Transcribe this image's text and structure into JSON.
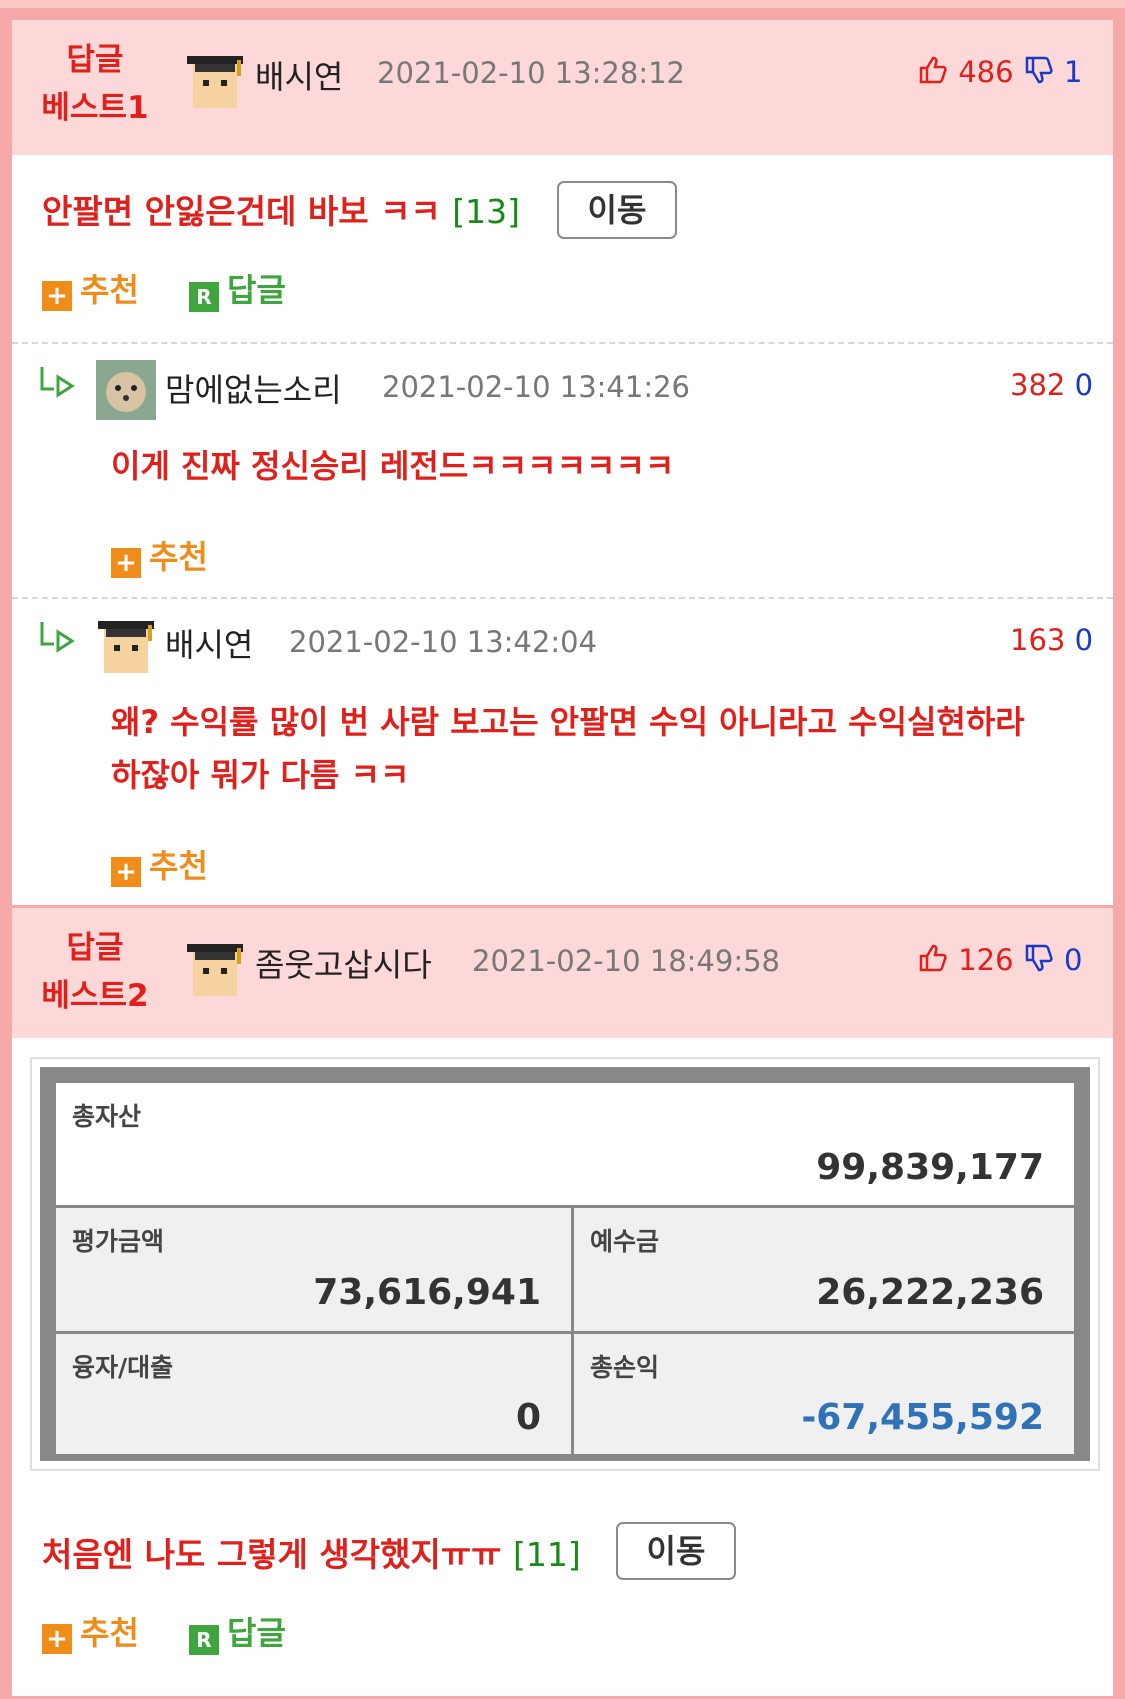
{
  "best1": {
    "label_line1": "답글",
    "label_line2": "베스트1",
    "nickname": "배시연",
    "timestamp": "2021-02-10 13:28:12",
    "up": "486",
    "down": "1",
    "title": "안팔면 안잃은건데 바보 ㅋㅋ",
    "comment_count": "[13]",
    "move_label": "이동",
    "recommend_label": "추천",
    "reply_label": "답글"
  },
  "replies": [
    {
      "nickname": "맘에없는소리",
      "timestamp": "2021-02-10 13:41:26",
      "up": "382",
      "down": "0",
      "text": "이게 진짜 정신승리 레전드ㅋㅋㅋㅋㅋㅋㅋ",
      "recommend_label": "추천"
    },
    {
      "nickname": "배시연",
      "timestamp": "2021-02-10 13:42:04",
      "up": "163",
      "down": "0",
      "text_line1": "왜? 수익률 많이 번 사람 보고는 안팔면 수익 아니라고 수익실현하라",
      "text_line2": "하잖아 뭐가 다름 ㅋㅋ",
      "recommend_label": "추천"
    }
  ],
  "best2": {
    "label_line1": "답글",
    "label_line2": "베스트2",
    "nickname": "좀웃고삽시다",
    "timestamp": "2021-02-10 18:49:58",
    "up": "126",
    "down": "0",
    "title": "처음엔 나도 그렇게 생각했지ㅠㅠ",
    "comment_count": "[11]",
    "move_label": "이동",
    "recommend_label": "추천",
    "reply_label": "답글"
  },
  "asset": {
    "total_label": "총자산",
    "total_value": "99,839,177",
    "eval_label": "평가금액",
    "eval_value": "73,616,941",
    "deposit_label": "예수금",
    "deposit_value": "26,222,236",
    "loan_label": "융자/대출",
    "loan_value": "0",
    "pnl_label": "총손익",
    "pnl_value": "-67,455,592"
  },
  "icons": {
    "thumbs_up": "thumbs-up-icon",
    "thumbs_down": "thumbs-down-icon",
    "reply_arrow": "reply-arrow-icon",
    "plus": "plus-icon",
    "r_badge": "r-badge-icon"
  },
  "colors": {
    "accent_red": "#e0201b",
    "accent_blue": "#1a39c9",
    "count_green": "#178a17",
    "recommend_orange": "#f08c1a",
    "reply_green": "#3fa53f",
    "header_pink": "#fdd8d8",
    "border_pink": "#f7a9a9",
    "loss_blue": "#2f72b8"
  }
}
